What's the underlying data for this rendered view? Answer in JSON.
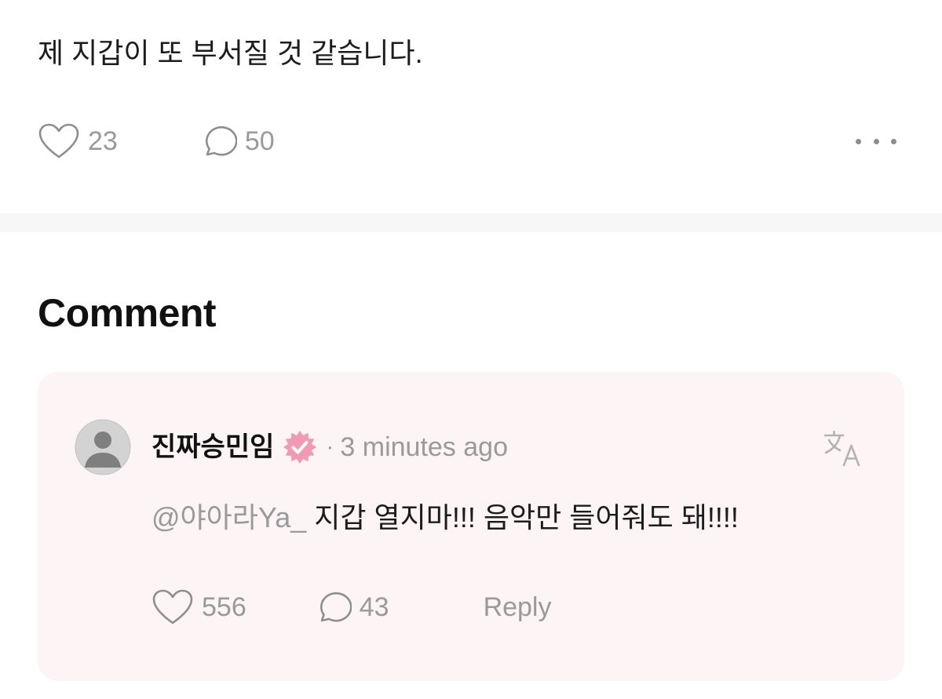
{
  "post": {
    "text": "제 지갑이 또 부서질 것 같습니다.",
    "like_count": "23",
    "comment_count": "50",
    "icons": [
      "heart-icon",
      "speech-bubble-icon",
      "more-dots-icon"
    ]
  },
  "comments_section": {
    "title": "Comment",
    "comments": [
      {
        "username": "진짜승민임",
        "verified": true,
        "separator": "·",
        "timestamp": "3 minutes ago",
        "mention": "@야아라Ya_",
        "text": " 지갑 열지마!!! 음악만 들어줘도 돼!!!!",
        "like_count": "556",
        "reply_count": "43",
        "reply_label": "Reply",
        "icons": [
          "avatar-placeholder-icon",
          "verified-badge-icon",
          "translate-icon",
          "heart-icon",
          "speech-bubble-icon"
        ]
      }
    ]
  },
  "colors": {
    "muted_text": "#9a9a9a",
    "card_background": "#fdf4f6",
    "verified_badge": "#f09ab6",
    "divider": "#f7f7f7"
  }
}
